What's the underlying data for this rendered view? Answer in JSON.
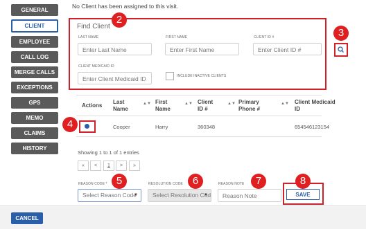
{
  "sidebar": {
    "items": [
      {
        "label": "GENERAL"
      },
      {
        "label": "CLIENT"
      },
      {
        "label": "EMPLOYEE"
      },
      {
        "label": "CALL LOG"
      },
      {
        "label": "MERGE CALLS"
      },
      {
        "label": "EXCEPTIONS"
      },
      {
        "label": "GPS"
      },
      {
        "label": "MEMO"
      },
      {
        "label": "CLAIMS"
      },
      {
        "label": "HISTORY"
      }
    ]
  },
  "notice": "No Client has been assigned to this visit.",
  "find_client": {
    "title": "Find Client",
    "last_name_label": "LAST NAME",
    "last_name_placeholder": "Enter Last Name",
    "first_name_label": "FIRST NAME",
    "first_name_placeholder": "Enter First Name",
    "client_id_label": "CLIENT ID #",
    "client_id_placeholder": "Enter Client ID #",
    "medicaid_label": "CLIENT MEDICAID ID",
    "medicaid_placeholder": "Enter Client Medicaid ID",
    "include_inactive_label": "INCLUDE INACTIVE CLIENTS"
  },
  "table": {
    "headers": {
      "actions": "Actions",
      "last_name_1": "Last",
      "last_name_2": "Name",
      "first_name_1": "First",
      "first_name_2": "Name",
      "client_id_1": "Client",
      "client_id_2": "ID #",
      "phone_1": "Primary",
      "phone_2": "Phone #",
      "medicaid_1": "Client Medicaid",
      "medicaid_2": "ID"
    },
    "rows": [
      {
        "last_name": "Cooper",
        "first_name": "Harry",
        "client_id": "360348",
        "phone": "",
        "medicaid_id": "654546123154"
      }
    ],
    "entries_text": "Showing 1 to 1 of 1 entries"
  },
  "pagination": {
    "first": "«",
    "prev": "<",
    "page": "1",
    "next": ">",
    "last": "»"
  },
  "bottom": {
    "reason_code_label": "REASON CODE *",
    "reason_code_value": "Select Reason Code",
    "resolution_code_label": "RESOLUTION CODE",
    "resolution_code_value": "Select Resolution Code",
    "reason_note_label": "REASON NOTE",
    "reason_note_placeholder": "Reason Note",
    "save_label": "SAVE",
    "cancel_label": "CANCEL"
  },
  "callouts": [
    "2",
    "3",
    "4",
    "5",
    "6",
    "7",
    "8"
  ],
  "colors": {
    "accent": "#2a5ea8",
    "callout": "#e02020",
    "nav": "#5a5a5a"
  }
}
